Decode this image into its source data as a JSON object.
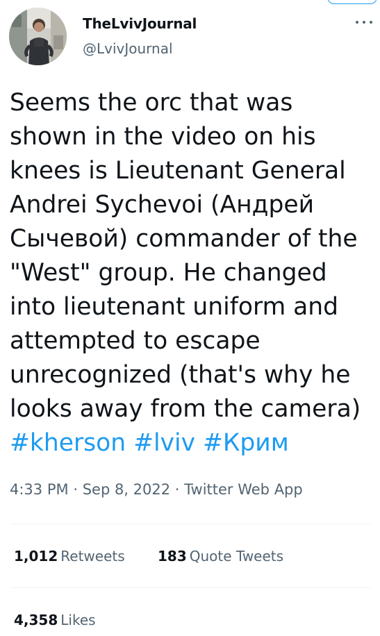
{
  "author": {
    "display_name": "TheLvivJournal",
    "handle": "@LvivJournal",
    "avatar_icon": "person-photo-avatar"
  },
  "tweet": {
    "lines": [
      "Seems the orc that was",
      "shown in the video on his",
      "knees is Lieutenant General",
      "Andrei Sychevoi (Андрей",
      "Сычевой) commander of the",
      "\"West\" group. He changed",
      "into lieutenant uniform and",
      "attempted to escape",
      "unrecognized (that's why he",
      "looks away from the camera)"
    ],
    "hashtags": [
      "#kherson",
      "#lviv",
      "#Крим"
    ]
  },
  "meta": {
    "time": "4:33 PM",
    "separator": "·",
    "date": "Sep 8, 2022",
    "source": "Twitter Web App"
  },
  "stats": {
    "retweets_count": "1,012",
    "retweets_label": "Retweets",
    "quote_count": "183",
    "quote_label": "Quote Tweets",
    "likes_count": "4,358",
    "likes_label": "Likes"
  },
  "colors": {
    "link": "#1d9bf0",
    "text": "#0f1419",
    "secondary": "#536471",
    "divider": "#eff3f4"
  },
  "icons": {
    "more": "more-horizontal-icon"
  }
}
